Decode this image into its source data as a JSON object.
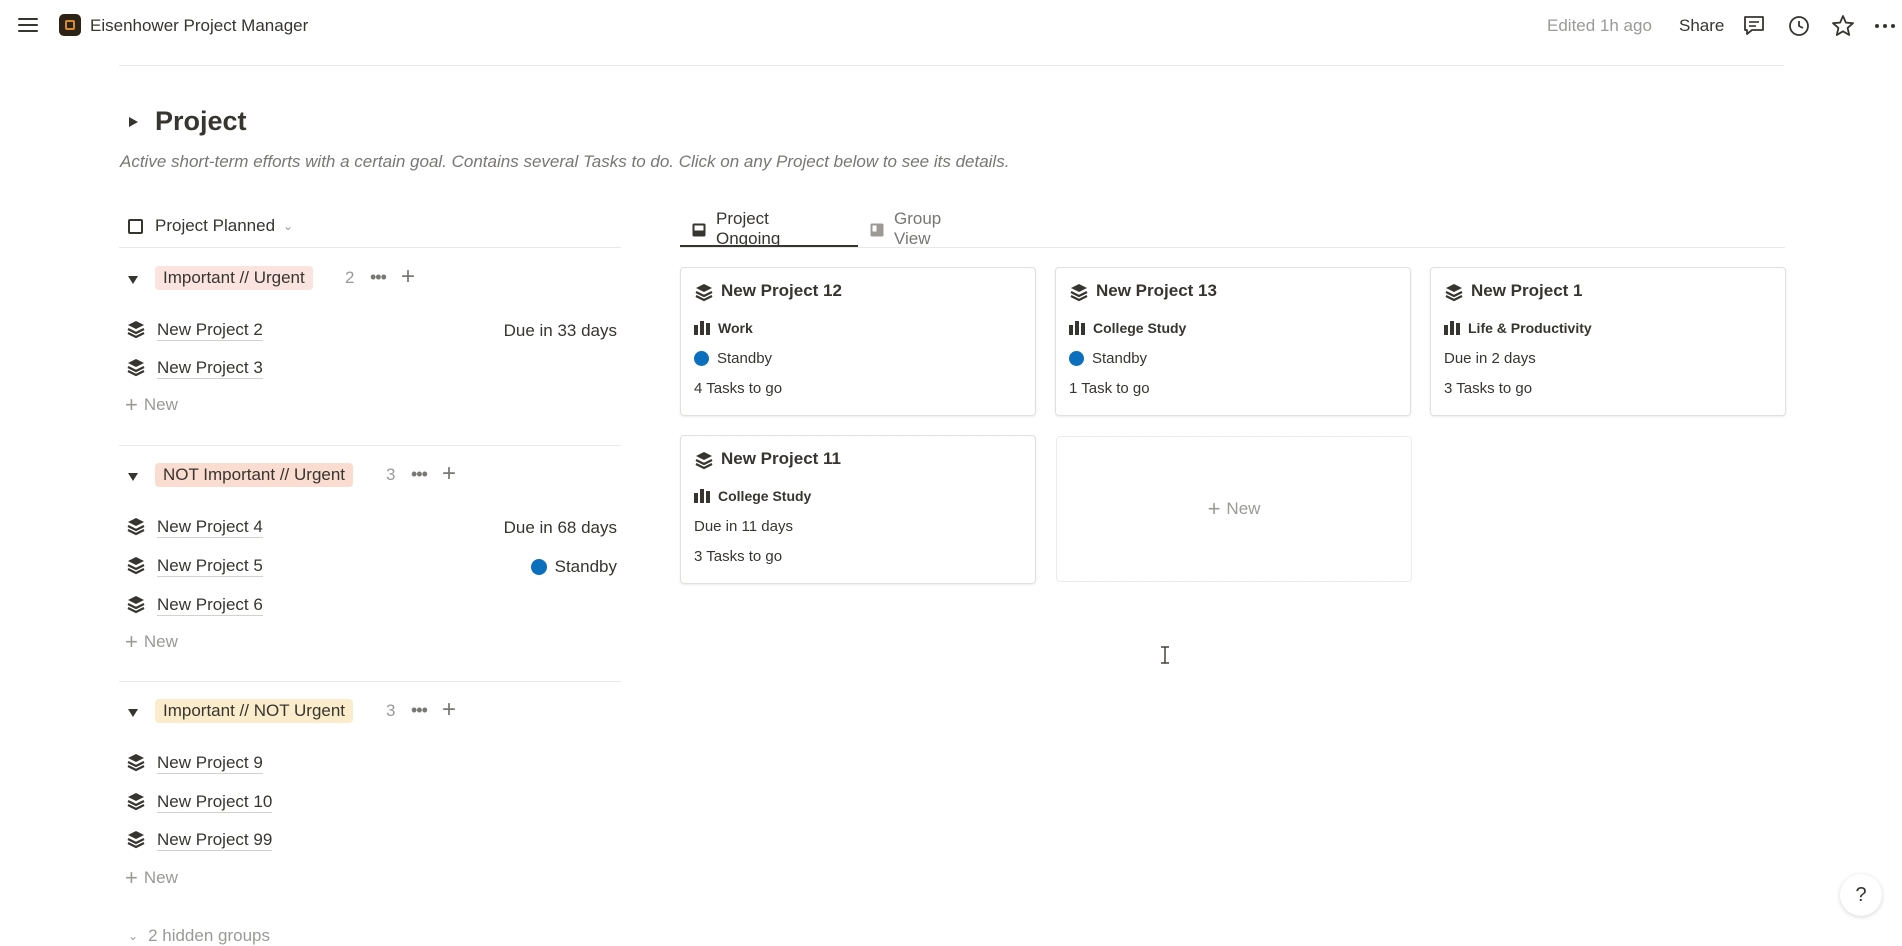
{
  "topbar": {
    "title": "Eisenhower Project Manager",
    "edited": "Edited 1h ago",
    "share": "Share",
    "icons": [
      "menu-icon",
      "comments-icon",
      "history-icon",
      "star-icon",
      "more-icon"
    ]
  },
  "header": {
    "title": "Project",
    "description": "Active short-term efforts with a certain goal. Contains several Tasks to do. Click on any Project below to see its details."
  },
  "list_view": {
    "name": "Project Planned",
    "groups": [
      {
        "label": "Important // Urgent",
        "color": "#fbe4e0",
        "count": "2",
        "rows": [
          {
            "name": "New Project 2",
            "right": "Due in 33 days"
          },
          {
            "name": "New Project 3",
            "right": ""
          }
        ]
      },
      {
        "label": "NOT Important // Urgent",
        "color": "#fadcd0",
        "count": "3",
        "rows": [
          {
            "name": "New Project 4",
            "right": "Due in 68 days"
          },
          {
            "name": "New Project 5",
            "right": "Standby"
          },
          {
            "name": "New Project 6",
            "right": ""
          }
        ]
      },
      {
        "label": "Important // NOT Urgent",
        "color": "#fbeccb",
        "count": "3",
        "rows": [
          {
            "name": "New Project 9",
            "right": ""
          },
          {
            "name": "New Project 10",
            "right": ""
          },
          {
            "name": "New Project 99",
            "right": ""
          }
        ]
      }
    ],
    "new_label": "New",
    "hidden_groups": "2 hidden groups"
  },
  "gallery": {
    "tabs": [
      {
        "label": "Project Ongoing",
        "active": true
      },
      {
        "label": "Group View",
        "active": false
      }
    ],
    "cards": [
      {
        "title": "New Project 12",
        "area": "Work",
        "line2": "Standby",
        "line3": "4 Tasks to go"
      },
      {
        "title": "New Project 13",
        "area": "College Study",
        "line2": "Standby",
        "line3": "1 Task to go"
      },
      {
        "title": "New Project 1",
        "area": "Life & Productivity",
        "line2": "Due in 2 days",
        "line3": "3 Tasks to go"
      },
      {
        "title": "New Project 11",
        "area": "College Study",
        "line2": "Due in 11 days",
        "line3": "3 Tasks to go"
      }
    ],
    "new_label": "New",
    "status_color": "#0b6fbd"
  },
  "help": "?"
}
